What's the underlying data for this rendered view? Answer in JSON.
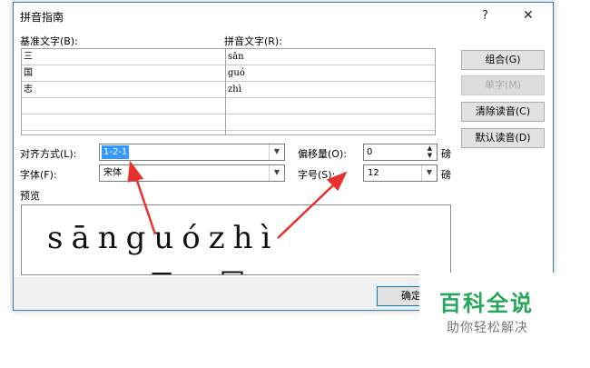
{
  "dialog": {
    "title": "拼音指南",
    "help_glyph": "?",
    "close_glyph": "✕"
  },
  "labels": {
    "base_text": "基准文字(B):",
    "pinyin_text": "拼音文字(R):",
    "alignment": "对齐方式(L):",
    "offset": "偏移量(O):",
    "font": "字体(F):",
    "size": "字号(S):",
    "preview": "预览",
    "unit_offset": "磅",
    "unit_size": "磅"
  },
  "rows": [
    {
      "base": "三",
      "pinyin": "sān"
    },
    {
      "base": "国",
      "pinyin": "guó"
    },
    {
      "base": "志",
      "pinyin": "zhì"
    },
    {
      "base": "",
      "pinyin": ""
    },
    {
      "base": "",
      "pinyin": ""
    }
  ],
  "buttons": {
    "group": "组合(G)",
    "single": "单字(M)",
    "clear": "清除读音(C)",
    "default": "默认读音(D)",
    "ok": "确定"
  },
  "fields": {
    "alignment_value": "1-2-1",
    "offset_value": "0",
    "font_value": "宋体",
    "size_value": "12"
  },
  "preview": {
    "pinyin": "sānguózhì",
    "hanzi": "三国"
  },
  "watermark": {
    "title": "百科全说",
    "subtitle": "助你轻松解决"
  },
  "colors": {
    "selection": "#3399ff",
    "arrow": "#e8312f",
    "brand_green": "#27a65a"
  }
}
